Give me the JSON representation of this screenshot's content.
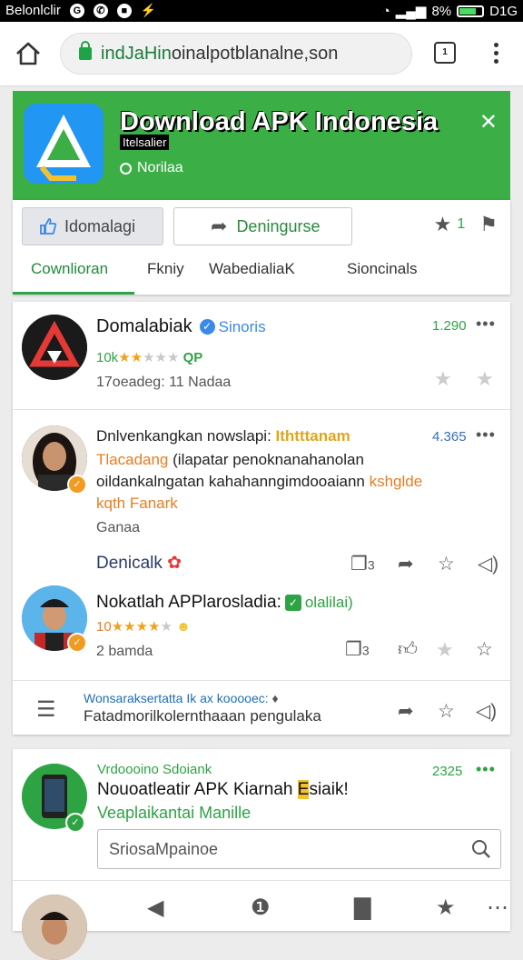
{
  "status_bar": {
    "carrier": "Belonlclir",
    "battery_pct": "8%",
    "time": "D1G"
  },
  "browser": {
    "url_domain": "indJaHin",
    "url_rest": "oinalpotblanalne,son"
  },
  "banner": {
    "title": "Download APK Indonesia",
    "subtitle": "Itelsalier",
    "tag": "Norilaa",
    "close": "✕"
  },
  "actions": {
    "primary_label": "Idomalagi",
    "secondary_label": "Deningurse",
    "star_count": "1"
  },
  "tabs": [
    {
      "label": "Cownlioran"
    },
    {
      "label": "Fkniy"
    },
    {
      "label": "WabedialiaK"
    },
    {
      "label": "Sioncinals"
    }
  ],
  "feed": {
    "item1": {
      "name": "Domalabiak",
      "verified_label": "Sinoris",
      "count": "1.290",
      "rating_prefix": "10k",
      "stars": 5,
      "stars_filled": 2,
      "rating_badge": "QP",
      "meta": "17oeadeg: 11 Nadaa"
    },
    "item2": {
      "title_line": "Dnlvenkangkan nowslapi:",
      "title_highlight": "Ithtttanam",
      "count": "4.365",
      "line2_orange": "Tlacadang",
      "line2_rest": "(ilapatar penoknanahanolan",
      "line3": "oildankalngatan kahahanngimdooaiann",
      "line3_orange": "kshglde",
      "line4_orange": "kqth Fanark",
      "caption": "Ganaa",
      "author": "Denicalk",
      "comments": "3"
    },
    "item3": {
      "name": "Nokatlah APPlarosladia:",
      "badge_text": "olalilai)",
      "rating_prefix": "10",
      "stars": 5,
      "stars_filled": 4,
      "meta": "2 bamda",
      "comments": "3"
    },
    "footer": {
      "title": "Wonsaraksertatta Ik ax kooooec:",
      "body": "Fatadmorilkolernthaaan pengulaka"
    }
  },
  "article": {
    "kicker": "Vrdoooino Sdoiank",
    "count": "2325",
    "headline_pre": "Nouoatleatir APK Kiarnah",
    "headline_mark": "E",
    "headline_post": "siaik!",
    "sub": "Veaplaikantai Manille",
    "search_placeholder": "SriosaMpainoe"
  },
  "colors": {
    "brand_green": "#3bae45",
    "accent_blue": "#3b89e8",
    "accent_orange": "#e67e22"
  }
}
